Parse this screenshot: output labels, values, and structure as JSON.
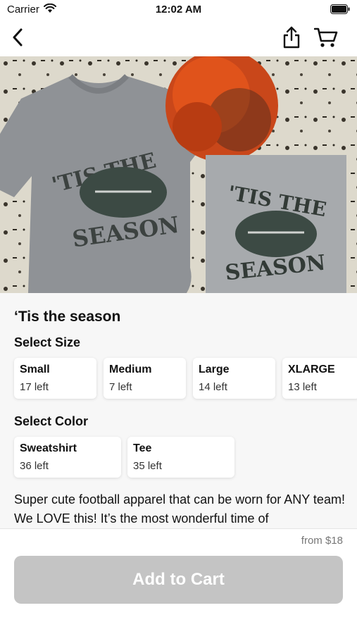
{
  "status_bar": {
    "carrier": "Carrier",
    "time": "12:02 AM"
  },
  "nav": {
    "back_icon": "chevron-left-icon",
    "share_icon": "share-icon",
    "cart_icon": "shopping-cart-icon"
  },
  "hero": {
    "left_shirt_text_top": "'TIS THE",
    "left_shirt_text_bottom": "SEASON",
    "right_shirt_text_top": "'TIS THE",
    "right_shirt_text_bottom": "SEASON"
  },
  "product": {
    "title": "‘Tis the season",
    "select_size_label": "Select Size",
    "sizes": [
      {
        "name": "Small",
        "stock": "17 left"
      },
      {
        "name": "Medium",
        "stock": "7 left"
      },
      {
        "name": "Large",
        "stock": "14 left"
      },
      {
        "name": "XLARGE",
        "stock": "13 left"
      }
    ],
    "select_color_label": "Select Color",
    "colors": [
      {
        "name": "Sweatshirt",
        "stock": "36 left"
      },
      {
        "name": "Tee",
        "stock": "35 left"
      }
    ],
    "description": "Super cute football apparel that can be worn for ANY team! We LOVE this! It’s the most wonderful time of"
  },
  "footer": {
    "price": "from $18",
    "add_to_cart_label": "Add to Cart"
  },
  "colors": {
    "button_disabled": "#c4c4c4",
    "shirt_gray": "#8f9296",
    "pom_orange": "#e0531b",
    "football_dark": "#3c4a44"
  }
}
